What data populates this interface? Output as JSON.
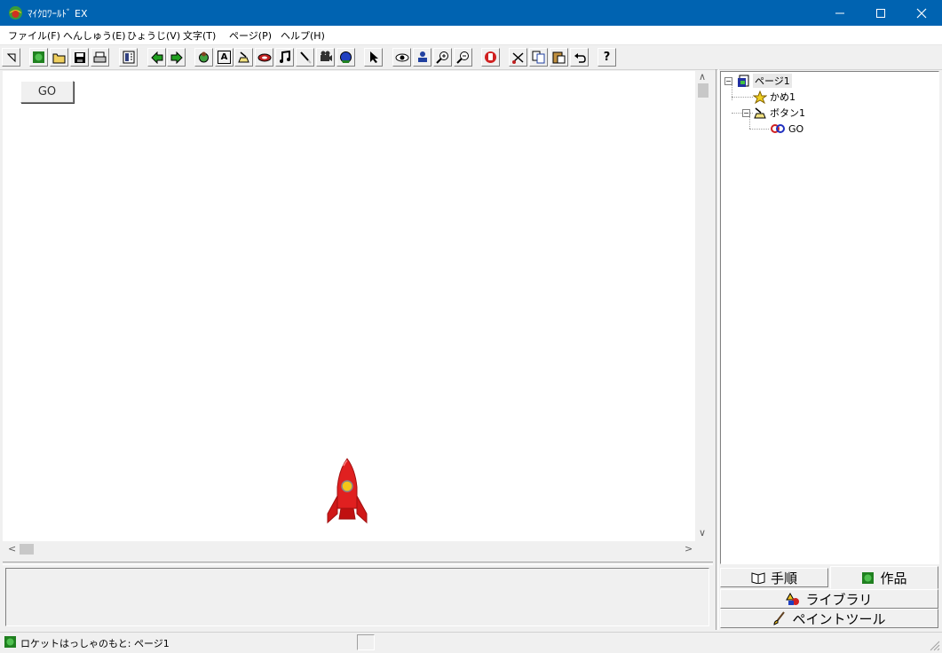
{
  "window": {
    "title": "ﾏｲｸﾛﾜｰﾙﾄﾞ EX",
    "minimize_glyph": "—",
    "maximize_glyph": "☐",
    "close_glyph": "✕"
  },
  "menu": {
    "items": [
      {
        "label": "ファイル(F)"
      },
      {
        "label": "へんしゅう(E)"
      },
      {
        "label": "ひょうじ(V)"
      },
      {
        "label": "文字(T)"
      },
      {
        "label": "ページ(P)"
      },
      {
        "label": "ヘルプ(H)"
      }
    ]
  },
  "toolbar": {
    "help_label": "?",
    "text_tool_label": "A",
    "icons": [
      "pointer-icon",
      "world-icon",
      "open-folder-icon",
      "save-icon",
      "print-icon",
      "panel-icon",
      "prev-page-icon",
      "next-page-icon",
      "hand-icon",
      "text-icon",
      "button-icon",
      "link-icon",
      "music-icon",
      "paint-icon",
      "camera-icon",
      "globe-icon",
      "select-arrow-icon",
      "eye-icon",
      "stamp-icon",
      "zoom-in-icon",
      "zoom-out-icon",
      "stop-icon",
      "cut-icon",
      "copy-icon",
      "paste-icon",
      "undo-icon",
      "help-icon"
    ]
  },
  "canvas": {
    "go_button_label": "GO"
  },
  "scroll": {
    "up": "∧",
    "down": "∨",
    "left": "<",
    "right": ">"
  },
  "tree": {
    "page": "ページ1",
    "turtle": "かめ1",
    "button": "ボタン1",
    "go": "GO",
    "expander": "−"
  },
  "tabs": {
    "procedure": "手順",
    "works": "作品",
    "library": "ライブラリ",
    "paint_tool": "ペイントツール"
  },
  "status": {
    "text": "ロケットはっしゃのもと: ページ1"
  },
  "colors": {
    "titlebar": "#0063b1",
    "rocket": "#e02020",
    "rocket_window": "#f5c518"
  }
}
